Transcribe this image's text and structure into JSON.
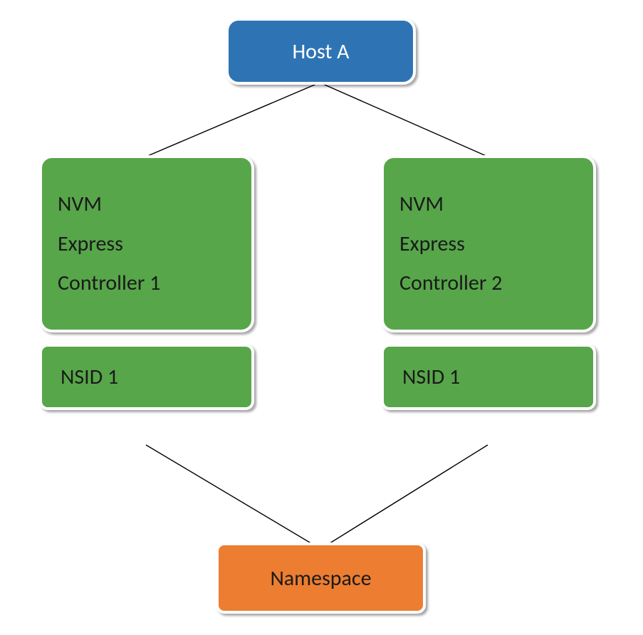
{
  "host": {
    "label": "Host A"
  },
  "controllers": [
    {
      "label_line1": "NVM",
      "label_line2": "Express",
      "label_line3": "Controller 1"
    },
    {
      "label_line1": "NVM",
      "label_line2": "Express",
      "label_line3": "Controller 2"
    }
  ],
  "nsids": [
    {
      "label": "NSID 1"
    },
    {
      "label": "NSID 1"
    }
  ],
  "namespace": {
    "label": "Namespace"
  },
  "colors": {
    "host_bg": "#2E74B5",
    "controller_bg": "#57A64A",
    "namespace_bg": "#EC7D31",
    "border": "#FFFFFF"
  }
}
